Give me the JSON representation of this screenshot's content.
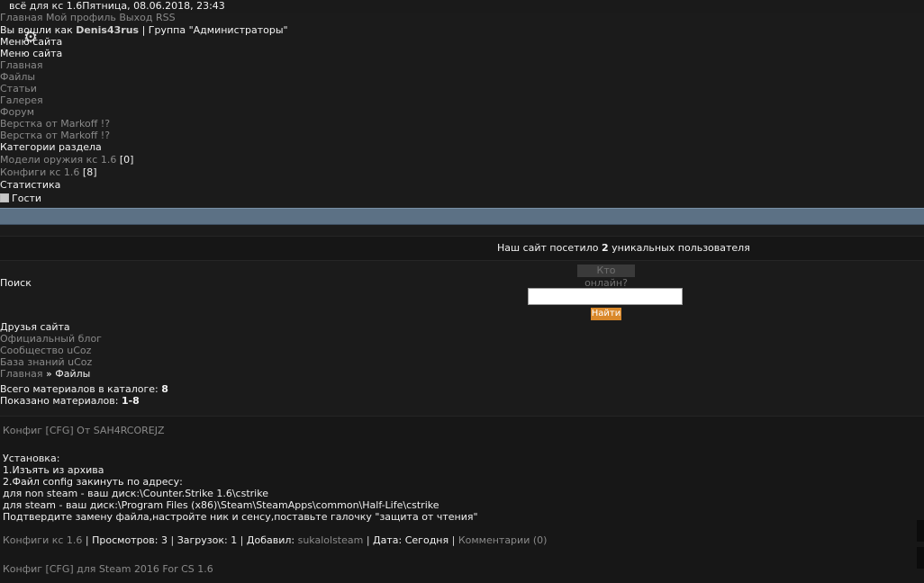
{
  "header": {
    "site_title": "всё для кс 1.6",
    "date": "Пятница, 08.06.2018, 23:43",
    "links": [
      "Главная",
      "Мой профиль",
      "Выход",
      "RSS"
    ],
    "login_prefix": "Вы вошли как ",
    "username": "Denis43rus",
    "group_text": " | Группа \"Администраторы\""
  },
  "menu": {
    "title_ghost": "Меню сайта",
    "title": "Меню сайта",
    "items": [
      "Главная",
      "Файлы",
      "Статьи",
      "Галерея",
      "Форум",
      "Верстка от Markoff !?",
      "Верстка от Markoff !?"
    ]
  },
  "categories": {
    "title": "Категории раздела",
    "items": [
      {
        "label": "Модели оружия кс 1.6",
        "count": "[0]"
      },
      {
        "label": "Конфиги кс 1.6",
        "count": "[8]"
      }
    ]
  },
  "stats": {
    "title": "Статистика",
    "guests_label": "Гости",
    "visited_text_before": "Наш сайт посетило ",
    "visited_count": "2",
    "visited_text_after": " уникальных пользователя",
    "who_online": "Кто онлайн?"
  },
  "search": {
    "title": "Поиск",
    "value": "",
    "button": "Найти"
  },
  "friends": {
    "title": "Друзья сайта",
    "items": [
      "Официальный блог",
      "Сообщество uCoz",
      "База знаний uCoz"
    ]
  },
  "breadcrumb": {
    "home": "Главная",
    "separator": " » ",
    "current": "Файлы"
  },
  "catalog": {
    "total_label": "Всего материалов в каталоге: ",
    "total_value": "8",
    "shown_label": "Показано материалов: ",
    "shown_value": "1-8"
  },
  "entries": [
    {
      "title": "Конфиг [CFG] От SAH4RCOREJZ",
      "body": [
        "Установка:",
        "1.Изъять из архива",
        "2.Файл config закинуть по адресу:",
        "для non steam - ваш диск:\\Counter.Strike 1.6\\cstrike",
        "для steam - ваш диск:\\Program Files (x86)\\Steam\\SteamApps\\common\\Half-Life\\cstrike",
        "Подтвердите замену файла,настройте ник и сенсу,поставьте галочку \"защита от чтения\""
      ],
      "category": "Конфиги кс 1.6",
      "views_label": "Просмотров: ",
      "views": "3",
      "downloads_label": "Загрузок: ",
      "downloads": "1",
      "added_label": "Добавил: ",
      "author": "sukalolsteam",
      "date_label": "Дата: ",
      "date": "Сегодня",
      "comments": "Комментарии (0)"
    },
    {
      "title": "Конфиг [CFG] для Steam 2016 For CS 1.6"
    }
  ],
  "colors": {
    "background": "#1b1b1b",
    "bar": "#5c7185",
    "button": "#d9882a"
  },
  "icons": [
    "gear-icon",
    "guests-icon"
  ]
}
